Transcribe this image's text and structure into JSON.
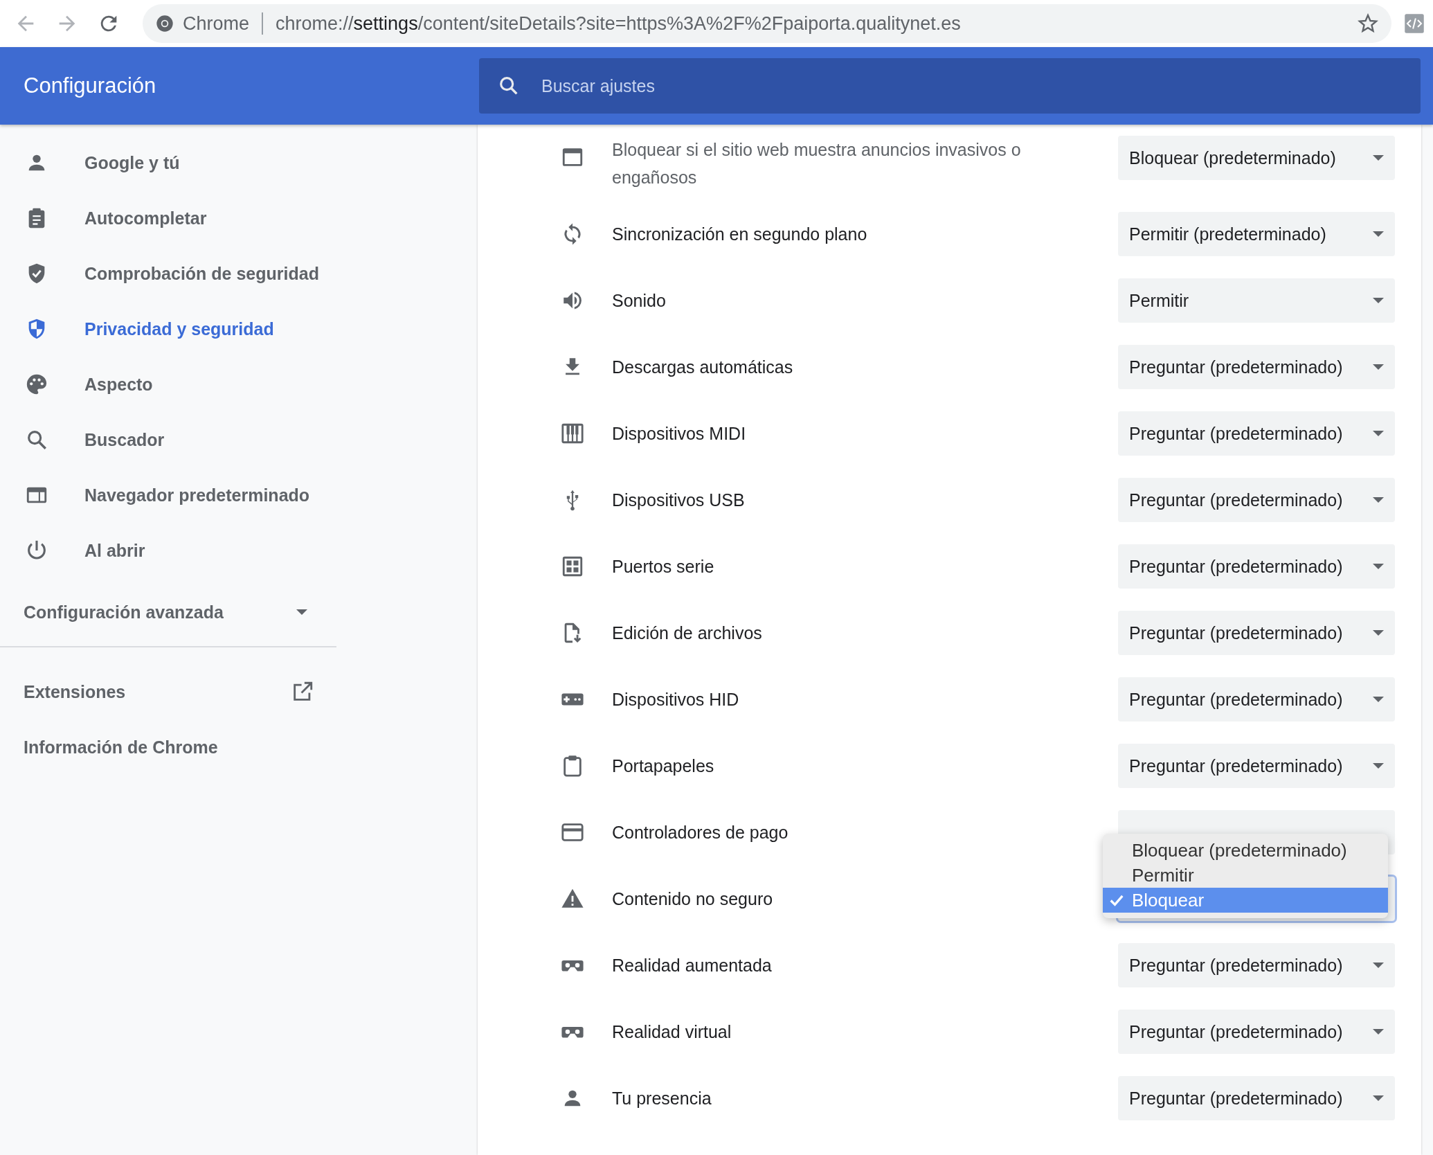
{
  "browser": {
    "chip": "Chrome",
    "url": "chrome://**settings**/content/siteDetails?site=https%3A%2F%2Fpaiporta.qualitynet.es"
  },
  "header": {
    "title": "Configuración",
    "search": {
      "placeholder": "Buscar ajustes"
    }
  },
  "sidebar": {
    "items": [
      {
        "kind": "person",
        "label": "Google y tú",
        "selected": false
      },
      {
        "kind": "clipboard",
        "label": "Autocompletar",
        "selected": false
      },
      {
        "kind": "shield-check",
        "label": "Comprobación de seguridad",
        "selected": false
      },
      {
        "kind": "shield",
        "label": "Privacidad y seguridad",
        "selected": true
      },
      {
        "kind": "palette",
        "label": "Aspecto",
        "selected": false
      },
      {
        "kind": "search",
        "label": "Buscador",
        "selected": false
      },
      {
        "kind": "browser",
        "label": "Navegador predeterminado",
        "selected": false
      },
      {
        "kind": "power",
        "label": "Al abrir",
        "selected": false
      }
    ],
    "advanced": {
      "label": "Configuración avanzada",
      "expanded": false
    },
    "links": [
      {
        "label": "Extensiones",
        "external": true
      },
      {
        "label": "Información de Chrome",
        "external": false
      }
    ]
  },
  "permissions": [
    {
      "kind": "ads",
      "description": "Bloquear si el sitio web muestra anuncios invasivos o engañosos",
      "value": "Bloquear (predeterminado)",
      "focused": false
    },
    {
      "kind": "sync",
      "label": "Sincronización en segundo plano",
      "value": "Permitir (predeterminado)",
      "focused": false
    },
    {
      "kind": "sound",
      "label": "Sonido",
      "value": "Permitir",
      "focused": false
    },
    {
      "kind": "download",
      "label": "Descargas automáticas",
      "value": "Preguntar (predeterminado)",
      "focused": false
    },
    {
      "kind": "midi",
      "label": "Dispositivos MIDI",
      "value": "Preguntar (predeterminado)",
      "focused": false
    },
    {
      "kind": "usb",
      "label": "Dispositivos USB",
      "value": "Preguntar (predeterminado)",
      "focused": false
    },
    {
      "kind": "serial",
      "label": "Puertos serie",
      "value": "Preguntar (predeterminado)",
      "focused": false
    },
    {
      "kind": "file",
      "label": "Edición de archivos",
      "value": "Preguntar (predeterminado)",
      "focused": false
    },
    {
      "kind": "hid",
      "label": "Dispositivos HID",
      "value": "Preguntar (predeterminado)",
      "focused": false
    },
    {
      "kind": "clipboard",
      "label": "Portapapeles",
      "value": "Preguntar (predeterminado)",
      "focused": false
    },
    {
      "kind": "card",
      "label": "Controladores de pago",
      "focused": false
    },
    {
      "kind": "warning",
      "label": "Contenido no seguro",
      "focused": true
    },
    {
      "kind": "vr",
      "label": "Realidad aumentada",
      "value": "Preguntar (predeterminado)",
      "focused": false
    },
    {
      "kind": "vr",
      "label": "Realidad virtual",
      "value": "Preguntar (predeterminado)",
      "focused": false
    },
    {
      "kind": "person",
      "label": "Tu presencia",
      "value": "Preguntar (predeterminado)",
      "focused": false
    }
  ],
  "dropdown_menu": {
    "options": [
      {
        "label": "Bloquear (predeterminado)",
        "selected": false
      },
      {
        "label": "Permitir",
        "selected": false
      },
      {
        "label": "Bloquear",
        "selected": true
      }
    ]
  }
}
